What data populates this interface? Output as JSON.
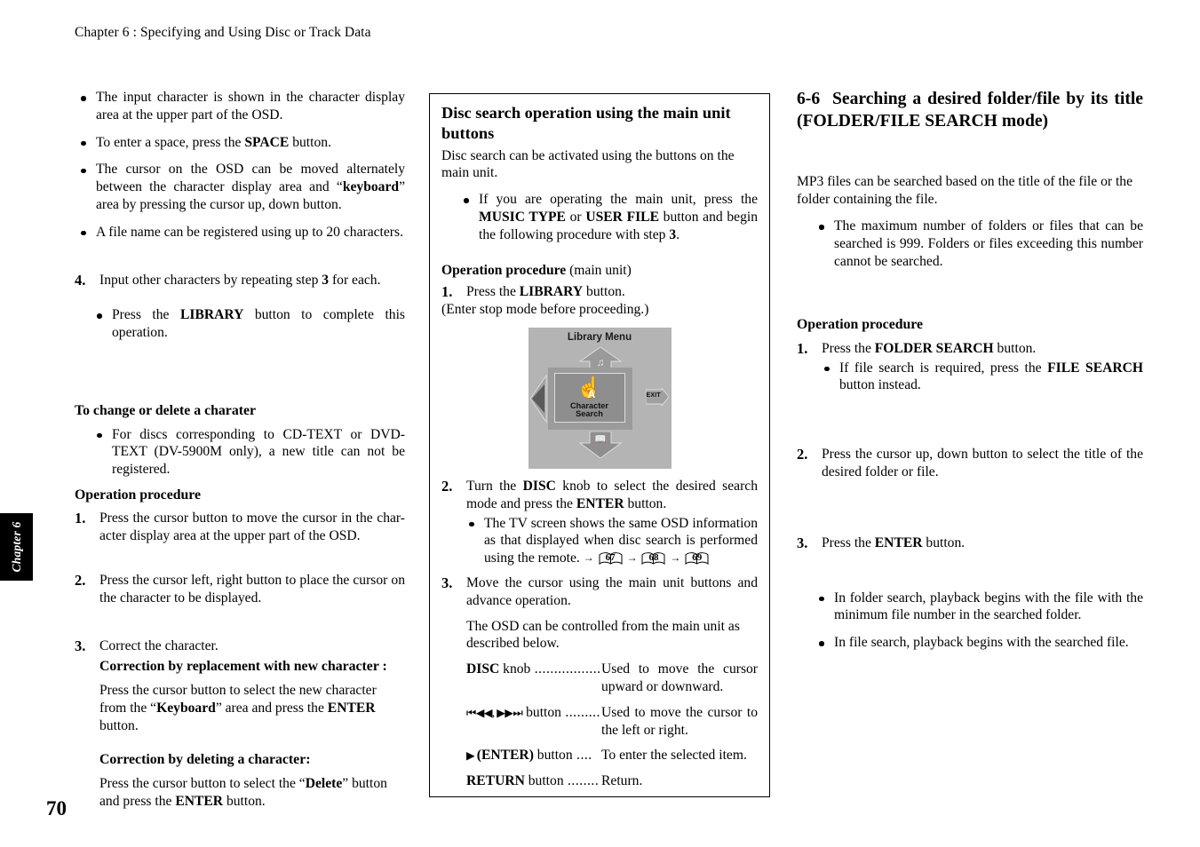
{
  "running_head": "Chapter 6 : Specifying and Using Disc or Track Data",
  "chapter_tab": "Chapter 6",
  "folio": "70",
  "left_column": {
    "bullets_top": [
      "The input character is shown in the character display area at the upper part of the OSD.",
      "To enter a space, press the SPACE button.",
      "The cursor on the OSD can be moved alternately between the character display area and “keyboard” area by pressing the cursor up, down button.",
      "A file name can be registered using up to 20 characters."
    ],
    "step4": {
      "num": "4.",
      "text": "Input other characters by repeating step 3 for each."
    },
    "bullet_library": "Press the LIBRARY button to complete this operation.",
    "change_delete_heading": "To change or delete a charater",
    "change_delete_bullet": "For discs corresponding to CD-TEXT or DVD-TEXT (DV-5900M only),  a new title can not be registered.",
    "operation_procedure_heading": "Operation procedure",
    "steps": [
      {
        "num": "1.",
        "text": "Press the cursor button to move the cursor in the char-acter display area at the upper part of the OSD."
      },
      {
        "num": "2.",
        "text": "Press the cursor left, right button to place the cursor on the character to be displayed."
      },
      {
        "num": "3.",
        "text": "Correct the character."
      }
    ],
    "correction_replacement_heading": "Correction by replacement with new character :",
    "correction_replacement_body": "Press the cursor button to select the new character from the “Keyboard” area and press the ENTER button.",
    "correction_delete_heading": "Correction by deleting a character:",
    "correction_delete_body": "Press the cursor button to select the “Delete” button and press the ENTER button."
  },
  "middle_column": {
    "box_title": "Disc search operation using the main unit buttons",
    "intro": "Disc search can be activated using the buttons on the main unit.",
    "bullet_main_unit": "If you are operating the main unit, press the MUSIC TYPE or USER FILE button and begin the following procedure with step 3.",
    "operation_procedure_heading": "Operation procedure",
    "operation_procedure_suffix": "(main unit)",
    "step1": {
      "num": "1.",
      "text": "Press the LIBRARY button."
    },
    "step1_note": "(Enter stop mode before proceeding.)",
    "osd_figure": {
      "title": "Library Menu",
      "center_label_line1": "Character",
      "center_label_line2": "Search",
      "exit_label": "EXIT",
      "bg_color": "#b4b4b4",
      "center_color": "#8e8e8e",
      "arrow_color": "#8b8b8b"
    },
    "step2": {
      "num": "2.",
      "text": "Turn the DISC knob to select the desired search mode and press the ENTER button."
    },
    "step2_bullet": "The TV screen shows the same OSD information as that displayed when disc search is performed using the remote.",
    "page_refs": [
      "67",
      "68",
      "69"
    ],
    "step3": {
      "num": "3.",
      "text": "Move the cursor using the main unit buttons and advance operation."
    },
    "step3_note": "The OSD can be controlled from the main unit as described below.",
    "controls": [
      {
        "term_bold": "DISC",
        "term_rest": " knob",
        "dots": " .................",
        "desc": "Used to move the cursor upward or downward."
      },
      {
        "term_glyph": "⏮◀◀, ▶▶⏭",
        "term_rest": " button",
        "dots": " .........",
        "desc": "Used to move the cursor to the left or right."
      },
      {
        "term_glyph": "▶ ",
        "term_bold": "(ENTER)",
        "term_rest": " button",
        "dots": " ....",
        "desc": "To enter the selected item."
      },
      {
        "term_bold": "RETURN",
        "term_rest": " button",
        "dots": " ........",
        "desc": "Return."
      }
    ]
  },
  "right_column": {
    "section_number": "6-6",
    "section_title": "Searching a desired folder/file by its title (FOLDER/FILE SEARCH  mode)",
    "intro": "MP3 files can be searched based on the title of the file or the folder containing the file.",
    "intro_bullet": "The maximum number of folders or files that can be searched is 999.  Folders or files exceeding this number cannot be searched.",
    "operation_procedure_heading": "Operation procedure",
    "step1": {
      "num": "1.",
      "text": "Press the FOLDER SEARCH button."
    },
    "step1_bullet": "If file search is required, press the FILE SEARCH button instead.",
    "step2": {
      "num": "2.",
      "text": "Press the cursor up, down button to select the title of the desired folder or file."
    },
    "step3": {
      "num": "3.",
      "text": "Press the ENTER button."
    },
    "end_bullets": [
      "In folder search, playback begins with the file with the minimum file number in the searched folder.",
      "In file search, playback begins with the searched file."
    ]
  }
}
